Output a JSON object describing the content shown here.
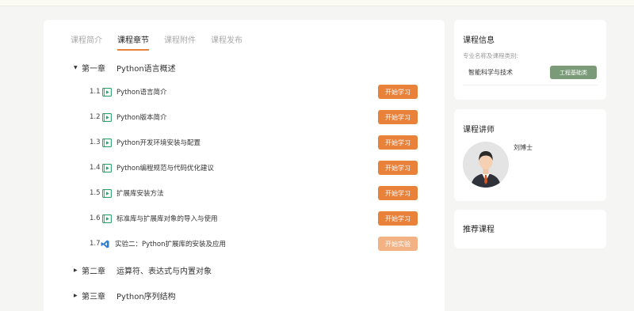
{
  "tabs": [
    "课程简介",
    "课程章节",
    "课程附件",
    "课程发布"
  ],
  "chapters": [
    {
      "num": "第一章",
      "title": "Python语言概述"
    },
    {
      "num": "第二章",
      "title": "运算符、表达式与内置对象"
    },
    {
      "num": "第三章",
      "title": "Python序列结构"
    }
  ],
  "lessons": [
    {
      "num": "1.1",
      "title": "Python语言简介",
      "button": "开始学习",
      "icon": "video-icon"
    },
    {
      "num": "1.2",
      "title": "Python版本简介",
      "button": "开始学习",
      "icon": "video-icon"
    },
    {
      "num": "1.3",
      "title": "Python开发环境安装与配置",
      "button": "开始学习",
      "icon": "video-icon"
    },
    {
      "num": "1.4",
      "title": "Python编程规范与代码优化建议",
      "button": "开始学习",
      "icon": "video-icon"
    },
    {
      "num": "1.5",
      "title": "扩展库安装方法",
      "button": "开始学习",
      "icon": "video-icon"
    },
    {
      "num": "1.6",
      "title": "标准库与扩展库对象的导入与使用",
      "button": "开始学习",
      "icon": "video-icon"
    },
    {
      "num": "1.7",
      "title": "实验二：Python扩展库的安装及应用",
      "button": "开始实验",
      "icon": "vscode-icon"
    }
  ],
  "course_info": {
    "title": "课程信息",
    "subtitle": "专业名称及课程类别:",
    "major": "智能科学与技术",
    "category": "工程基础类"
  },
  "teacher": {
    "title": "课程讲师",
    "name": "刘博士"
  },
  "recommend": {
    "title": "推荐课程"
  },
  "colors": {
    "accent": "#e8813a",
    "accent_light": "#f2b284",
    "badge": "#7b9a78",
    "video_icon": "#2e9e6a",
    "vscode_icon": "#2d7fd3"
  }
}
